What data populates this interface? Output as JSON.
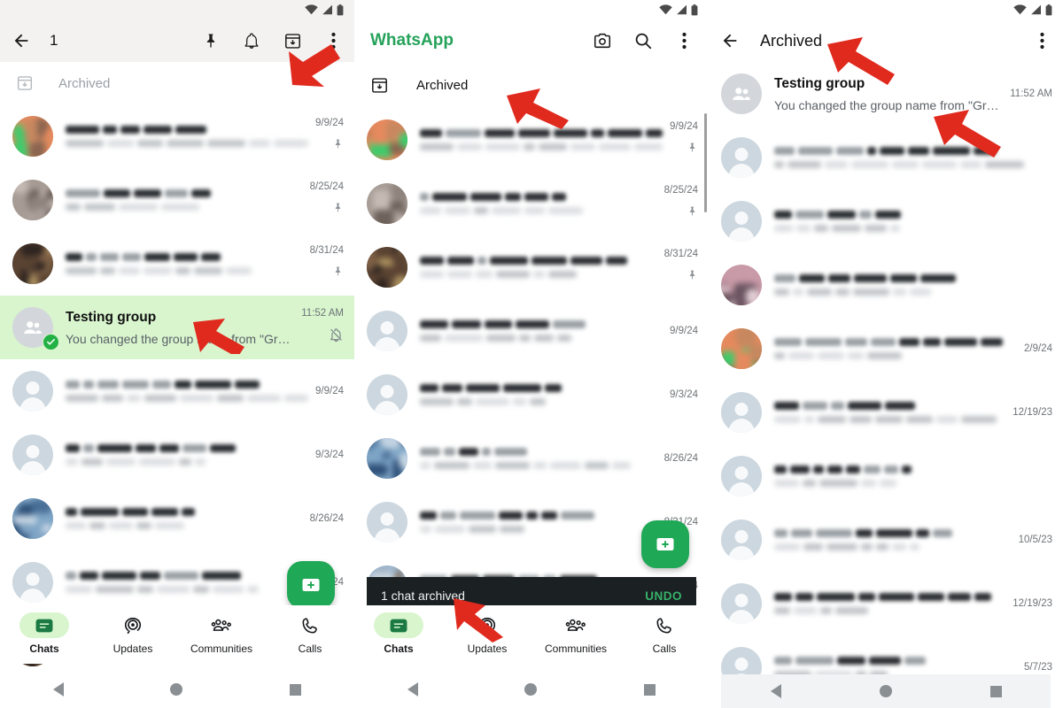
{
  "app": {
    "name": "WhatsApp",
    "brand_color": "#25A25A",
    "selection_color": "#D8F5CE",
    "accent_dark": "#1B2023"
  },
  "panel1": {
    "appbar": {
      "back_icon": "arrow-back-icon",
      "title": "1",
      "actions": [
        {
          "icon": "pin-icon",
          "name": "pin-chat-button"
        },
        {
          "icon": "bell-icon",
          "name": "mute-chat-button"
        },
        {
          "icon": "archive-icon",
          "name": "archive-chat-button"
        },
        {
          "icon": "more-vert-icon",
          "name": "overflow-menu-button"
        }
      ]
    },
    "archived": {
      "label": "Archived",
      "icon": "archive-icon"
    },
    "rows": [
      {
        "kind": "redacted",
        "time": "9/9/24",
        "pinned": true,
        "avatar": "photo-orange"
      },
      {
        "kind": "redacted",
        "time": "8/25/24",
        "pinned": true,
        "avatar": "photo-gray"
      },
      {
        "kind": "redacted",
        "time": "8/31/24",
        "pinned": true,
        "avatar": "photo-brown"
      },
      {
        "kind": "real",
        "title": "Testing group",
        "preview": "You changed the group name from \"Grupo de…",
        "time": "11:52 AM",
        "selected": true,
        "muted_icon": "bell-off-icon",
        "avatar": "group-placeholder",
        "checked": true
      },
      {
        "kind": "redacted",
        "time": "9/9/24",
        "pinned": false,
        "avatar": "person-placeholder"
      },
      {
        "kind": "redacted",
        "time": "9/3/24",
        "pinned": false,
        "avatar": "person-placeholder"
      },
      {
        "kind": "redacted",
        "time": "8/26/24",
        "pinned": false,
        "avatar": "photo-blue"
      },
      {
        "kind": "redacted",
        "time": "8/21/24",
        "pinned": false,
        "avatar": "person-placeholder"
      },
      {
        "kind": "redacted",
        "time": "",
        "pinned": false,
        "avatar": "photo-brown"
      }
    ],
    "fab": {
      "icon": "new-chat-icon",
      "name": "new-chat-fab"
    },
    "nav": [
      {
        "label": "Chats",
        "icon": "chats-icon",
        "active": true
      },
      {
        "label": "Updates",
        "icon": "updates-icon",
        "active": false
      },
      {
        "label": "Communities",
        "icon": "communities-icon",
        "active": false
      },
      {
        "label": "Calls",
        "icon": "calls-icon",
        "active": false
      }
    ]
  },
  "panel2": {
    "appbar": {
      "title": "WhatsApp",
      "actions": [
        {
          "icon": "camera-icon",
          "name": "camera-button"
        },
        {
          "icon": "search-icon",
          "name": "search-button"
        },
        {
          "icon": "more-vert-icon",
          "name": "overflow-menu-button"
        }
      ]
    },
    "archived": {
      "label": "Archived",
      "icon": "archive-icon"
    },
    "rows": [
      {
        "kind": "redacted",
        "time": "9/9/24",
        "pinned": true,
        "avatar": "photo-orange"
      },
      {
        "kind": "redacted",
        "time": "8/25/24",
        "pinned": true,
        "avatar": "photo-gray"
      },
      {
        "kind": "redacted",
        "time": "8/31/24",
        "pinned": true,
        "avatar": "photo-brown"
      },
      {
        "kind": "redacted",
        "time": "9/9/24",
        "pinned": false,
        "avatar": "person-placeholder"
      },
      {
        "kind": "redacted",
        "time": "9/3/24",
        "pinned": false,
        "avatar": "person-placeholder"
      },
      {
        "kind": "redacted",
        "time": "8/26/24",
        "pinned": false,
        "avatar": "photo-blue"
      },
      {
        "kind": "redacted",
        "time": "8/21/24",
        "pinned": false,
        "avatar": "person-placeholder"
      },
      {
        "kind": "redacted",
        "time": "8/14/24",
        "pinned": false,
        "avatar": "photo-mixed"
      }
    ],
    "fab": {
      "icon": "new-chat-icon",
      "name": "new-chat-fab"
    },
    "snackbar": {
      "message": "1 chat archived",
      "action": "UNDO"
    },
    "nav": [
      {
        "label": "Chats",
        "icon": "chats-icon",
        "active": true
      },
      {
        "label": "Updates",
        "icon": "updates-icon",
        "active": false
      },
      {
        "label": "Communities",
        "icon": "communities-icon",
        "active": false
      },
      {
        "label": "Calls",
        "icon": "calls-icon",
        "active": false
      }
    ]
  },
  "panel3": {
    "appbar": {
      "back_icon": "arrow-back-icon",
      "title": "Archived",
      "actions": [
        {
          "icon": "more-vert-icon",
          "name": "overflow-menu-button"
        }
      ]
    },
    "rows": [
      {
        "kind": "real",
        "title": "Testing group",
        "preview": "You changed the group name from \"Grupo de pr…",
        "time": "11:52 AM",
        "avatar": "group-placeholder"
      },
      {
        "kind": "redacted",
        "time": "",
        "avatar": "person-placeholder"
      },
      {
        "kind": "redacted",
        "time": "",
        "avatar": "person-placeholder"
      },
      {
        "kind": "redacted",
        "time": "",
        "avatar": "photo-pink"
      },
      {
        "kind": "redacted",
        "time": "2/9/24",
        "avatar": "photo-orange"
      },
      {
        "kind": "redacted",
        "time": "12/19/23",
        "avatar": "person-placeholder"
      },
      {
        "kind": "redacted",
        "time": "",
        "avatar": "person-placeholder"
      },
      {
        "kind": "redacted",
        "time": "10/5/23",
        "avatar": "person-placeholder"
      },
      {
        "kind": "redacted",
        "time": "12/19/23",
        "avatar": "person-placeholder"
      },
      {
        "kind": "redacted",
        "time": "5/7/23",
        "avatar": "person-placeholder"
      }
    ]
  },
  "annotations": [
    {
      "name": "arrow-to-archive-button",
      "panel": 1
    },
    {
      "name": "arrow-to-selected-chat",
      "panel": 1
    },
    {
      "name": "arrow-to-archived-row",
      "panel": 2
    },
    {
      "name": "arrow-to-snackbar",
      "panel": 2
    },
    {
      "name": "arrow-to-archived-title",
      "panel": 3
    },
    {
      "name": "arrow-to-testing-group-row",
      "panel": 3
    }
  ]
}
